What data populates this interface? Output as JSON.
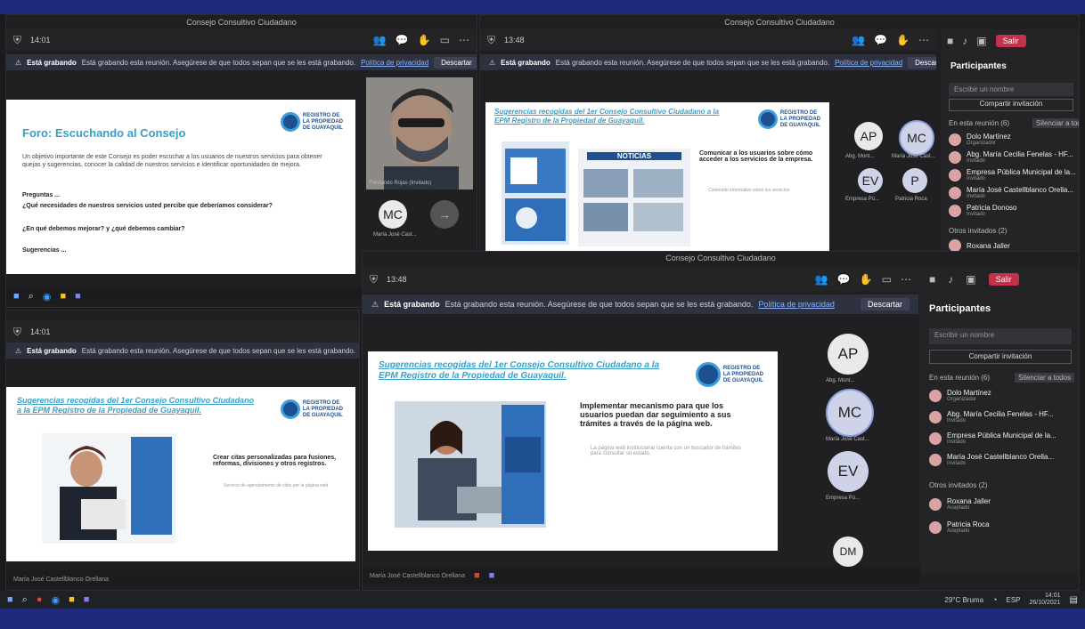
{
  "window_titles": {
    "top_left": "Consejo Consultivo Ciudadano",
    "top_right": "Consejo Consultivo Ciudadano",
    "bottom_right": "Consejo Consultivo Ciudadano"
  },
  "timers": {
    "top_left": "14:01",
    "top_right": "13:48",
    "bottom_left": "14:01",
    "bottom_right": "13:48"
  },
  "banner": {
    "bold": "Está grabando",
    "text": "Está grabando esta reunión. Asegúrese de que todos sepan que se les está grabando.",
    "link": "Política de privacidad",
    "dismiss": "Descartar"
  },
  "leave_label": "Salir",
  "slide1": {
    "title": "Foro: Escuchando al Consejo",
    "body": "Un objetivo importante de este Consejo es poder escuchar a los usuarios de nuestros servicios para obtener quejas y sugerencias, conocer la calidad de nuestros servicios e identificar oportunidades de mejora.",
    "q_header": "Preguntas ...",
    "q1": "¿Qué necesidades de nuestros servicios usted percibe que deberíamos considerar?",
    "q2": "¿En qué debemos mejorar? y ¿qué debemos cambiar?",
    "q3": "Sugerencias ..."
  },
  "slide_common_title": "Sugerencias recogidas del 1er Consejo Consultivo Ciudadano a la EPM Registro de la Propiedad de Guayaquil.",
  "slide2": {
    "bullet": "Comunicar a los usuarios sobre cómo acceder a los servicios de la empresa.",
    "hint": "Contenido informativo sobre los servicios",
    "news": "NOTICIAS"
  },
  "slide3": {
    "bullet": "Crear citas personalizadas para fusiones, reformas, divisiones y otros registros.",
    "hint": "Servicio de agendamiento de citas por la página web"
  },
  "slide4": {
    "bullet": "Implementar mecanismo para que los usuarios puedan dar seguimiento a sus trámites a través de la página web.",
    "hint": "La página web institucional cuenta con un buscador de trámites para consultar su estado."
  },
  "logo": {
    "line1": "REGISTRO DE",
    "line2": "LA PROPIEDAD",
    "line3": "DE GUAYAQUIL"
  },
  "tiles_top_right": [
    {
      "initials": "AP",
      "label": "Abg. Mont..."
    },
    {
      "initials": "MC",
      "label": "María José Cast..."
    },
    {
      "initials": "EV",
      "label": "Empresa Pú..."
    },
    {
      "initials": "P",
      "label": "Patricia Roca"
    }
  ],
  "tiles_top_left": [
    {
      "initials": "MC",
      "label": "María José Cast..."
    }
  ],
  "camera_label": "Fernando Rojas (Invitado)",
  "tiles_bottom_right": [
    {
      "initials": "AP",
      "label": "Abg. Mont..."
    },
    {
      "initials": "MC",
      "label": "María José Cast..."
    },
    {
      "initials": "EV",
      "label": "Empresa Pú..."
    },
    {
      "initials": "DM",
      "label": ""
    }
  ],
  "participants": {
    "title": "Participantes",
    "search": "Escribir un nombre",
    "share": "Compartir invitación",
    "in_meeting": "En esta reunión (6)",
    "mute_all": "Silenciar a todos",
    "others": "Otros invitados (2)",
    "people": [
      {
        "name": "Dolo Martínez",
        "role": "Organizador"
      },
      {
        "name": "Abg. María Cecilia Fenelas - HF...",
        "role": "Invitado"
      },
      {
        "name": "Empresa Pública Municipal de la...",
        "role": "Invitado"
      },
      {
        "name": "María José Castellblanco Orella...",
        "role": "Invitado"
      },
      {
        "name": "Patricia Donoso",
        "role": "Invitado"
      }
    ],
    "others_list": [
      {
        "name": "Roxana Jaller",
        "role": "Aceptado"
      },
      {
        "name": "Patricia Roca",
        "role": "Aceptado"
      }
    ]
  },
  "presenter_bar": "María José Castellblanco Orellana",
  "clock": {
    "time": "14:01",
    "date": "26/10/2021"
  },
  "tray": {
    "weather": "29°C Bruma",
    "lang": "ESP"
  }
}
